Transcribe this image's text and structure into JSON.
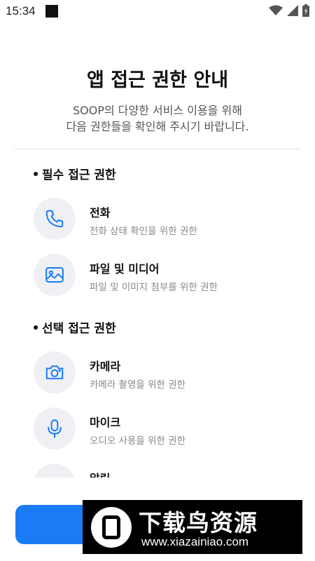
{
  "status_bar": {
    "time": "15:34"
  },
  "header": {
    "title": "앱 접근 권한 안내",
    "subtitle_line1": "SOOP의 다양한 서비스 이용을 위해",
    "subtitle_line2": "다음 권한들을 확인해 주시기 바랍니다."
  },
  "required": {
    "title": "필수 접근 권한",
    "items": [
      {
        "name": "전화",
        "desc": "전화 상태 확인을 위한 권한",
        "icon": "phone-icon"
      },
      {
        "name": "파일 및 미디어",
        "desc": "파일 및 이미지 첨부를 위한 권한",
        "icon": "image-icon"
      }
    ]
  },
  "optional": {
    "title": "선택 접근 권한",
    "items": [
      {
        "name": "카메라",
        "desc": "카메라 촬영을 위한 권한",
        "icon": "camera-icon"
      },
      {
        "name": "마이크",
        "desc": "오디오 사용을 위한 권한",
        "icon": "microphone-icon"
      },
      {
        "name": "알림",
        "desc": "",
        "icon": "bell-icon"
      }
    ]
  },
  "watermark": {
    "title": "下载鸟资源",
    "url": "www.xiazainiao.com"
  },
  "colors": {
    "accent": "#1a7cf5",
    "icon_bg": "#eef0f3",
    "icon_stroke": "#1a7cf5"
  }
}
